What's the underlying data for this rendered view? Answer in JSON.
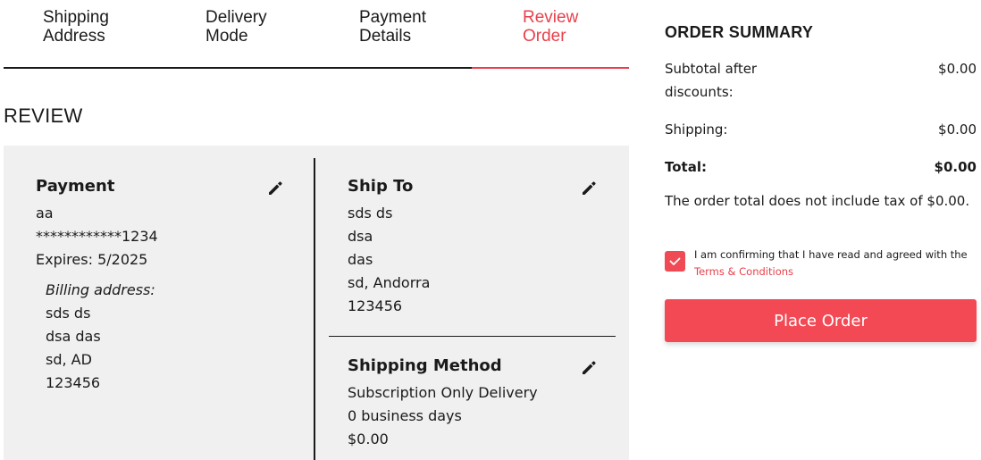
{
  "steps": [
    {
      "line1": "Shipping",
      "line2": "Address"
    },
    {
      "line1": "Delivery",
      "line2": "Mode"
    },
    {
      "line1": "Payment",
      "line2": "Details"
    },
    {
      "line1": "Review",
      "line2": "Order"
    }
  ],
  "active_step": 3,
  "review": {
    "title": "REVIEW",
    "payment": {
      "heading": "Payment",
      "name": "aa",
      "card": "************1234",
      "expires": "Expires: 5/2025",
      "billing_label": "Billing address:",
      "billing_lines": [
        "sds ds",
        "dsa das",
        "sd, AD",
        "123456"
      ]
    },
    "ship_to": {
      "heading": "Ship To",
      "lines": [
        "sds ds",
        "dsa",
        "das",
        "sd, Andorra",
        "123456"
      ]
    },
    "shipping_method": {
      "heading": "Shipping Method",
      "lines": [
        "Subscription Only Delivery",
        "0 business days",
        "$0.00"
      ]
    }
  },
  "summary": {
    "title": "ORDER SUMMARY",
    "subtotal_label_line1": "Subtotal after",
    "subtotal_label_line2": "discounts:",
    "subtotal_value": "$0.00",
    "shipping_label": "Shipping:",
    "shipping_value": "$0.00",
    "total_label": "Total:",
    "total_value": "$0.00",
    "tax_note": "The order total does not include tax of $0.00.",
    "confirm_text": "I am confirming that I have read and agreed with the",
    "terms_link": "Terms & Conditions",
    "terms_checked": true,
    "place_order_label": "Place Order"
  },
  "colors": {
    "accent": "#e8404b",
    "button": "#f34954",
    "panel_bg": "#f0f0f0"
  },
  "icons": {
    "edit": "pencil-icon",
    "check": "checkmark-icon"
  }
}
